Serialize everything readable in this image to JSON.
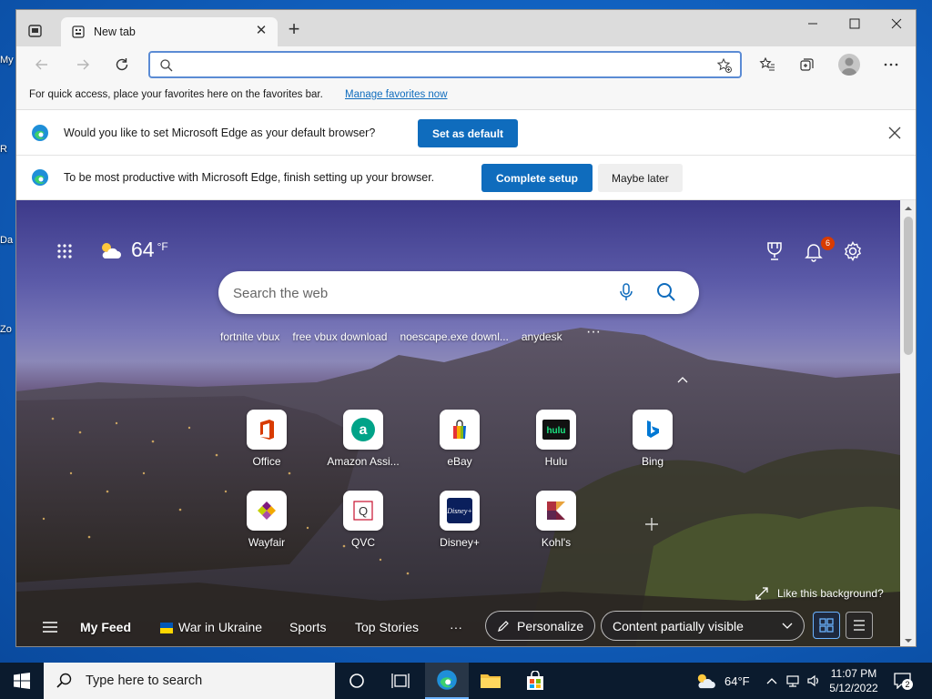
{
  "desktop": {
    "labels": [
      "My",
      "R",
      "Da",
      "Zo"
    ]
  },
  "browser": {
    "tab": {
      "title": "New tab"
    },
    "address": {
      "placeholder": "",
      "value": ""
    },
    "favorites_bar": {
      "text": "For quick access, place your favorites here on the favorites bar.",
      "link": "Manage favorites now"
    },
    "infobars": [
      {
        "message": "Would you like to set Microsoft Edge as your default browser?",
        "primary": "Set as default"
      },
      {
        "message": "To be most productive with Microsoft Edge, finish setting up your browser.",
        "primary": "Complete setup",
        "secondary": "Maybe later"
      }
    ]
  },
  "ntp": {
    "weather": {
      "temp": "64",
      "unit": "°F",
      "icon": "partly-sunny-icon"
    },
    "notifications_count": "6",
    "search": {
      "placeholder": "Search the web"
    },
    "suggestions": [
      "fortnite vbux",
      "free vbux download",
      "noescape.exe downl...",
      "anydesk"
    ],
    "more": "···",
    "tiles_row1": [
      {
        "label": "Office",
        "icon": "office-icon",
        "color": "#d83b01"
      },
      {
        "label": "Amazon Assi...",
        "icon": "amazon-icon",
        "color": "#00a388"
      },
      {
        "label": "eBay",
        "icon": "ebay-icon",
        "color": "#e53238"
      },
      {
        "label": "Hulu",
        "icon": "hulu-icon",
        "color": "#1ce783"
      },
      {
        "label": "Bing",
        "icon": "bing-icon",
        "color": "#0078d4"
      }
    ],
    "tiles_row2": [
      {
        "label": "Wayfair",
        "icon": "wayfair-icon",
        "color": "#7f187f"
      },
      {
        "label": "QVC",
        "icon": "qvc-icon",
        "color": "#c8102e"
      },
      {
        "label": "Disney+",
        "icon": "disney-icon",
        "color": "#0a1f5c"
      },
      {
        "label": "Kohl's",
        "icon": "kohls-icon",
        "color": "#7a1f3d"
      }
    ],
    "like_background": "Like this background?",
    "feed": {
      "my_feed": "My Feed",
      "items": [
        "War in Ukraine",
        "Sports",
        "Top Stories"
      ],
      "more": "···",
      "personalize": "Personalize",
      "content_visibility": "Content partially visible"
    }
  },
  "taskbar": {
    "search_placeholder": "Type here to search",
    "weather_temp": "64°F",
    "time": "11:07 PM",
    "date": "5/12/2022",
    "notification_count": "2"
  }
}
